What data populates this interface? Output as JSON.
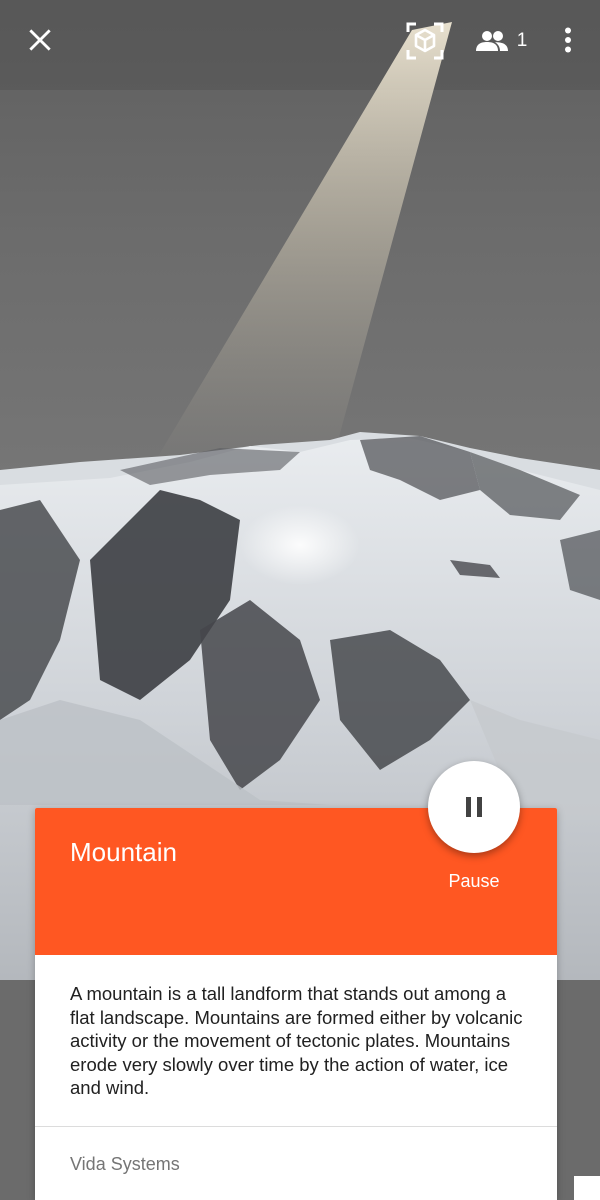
{
  "toolbar": {
    "close_icon": "close-icon",
    "ar_icon": "ar-cube-icon",
    "people_icon": "people-icon",
    "people_count": "1",
    "more_icon": "more-vertical-icon"
  },
  "card": {
    "title": "Mountain",
    "description": "A mountain is a tall landform that stands out among a flat landscape. Mountains are formed either by volcanic activity or the movement of tectonic plates. Mountains erode very slowly over time by the action of water, ice and wind.",
    "publisher": "Vida Systems",
    "header_color": "#ff5722"
  },
  "playback": {
    "pause_label": "Pause",
    "pause_icon": "pause-icon"
  }
}
